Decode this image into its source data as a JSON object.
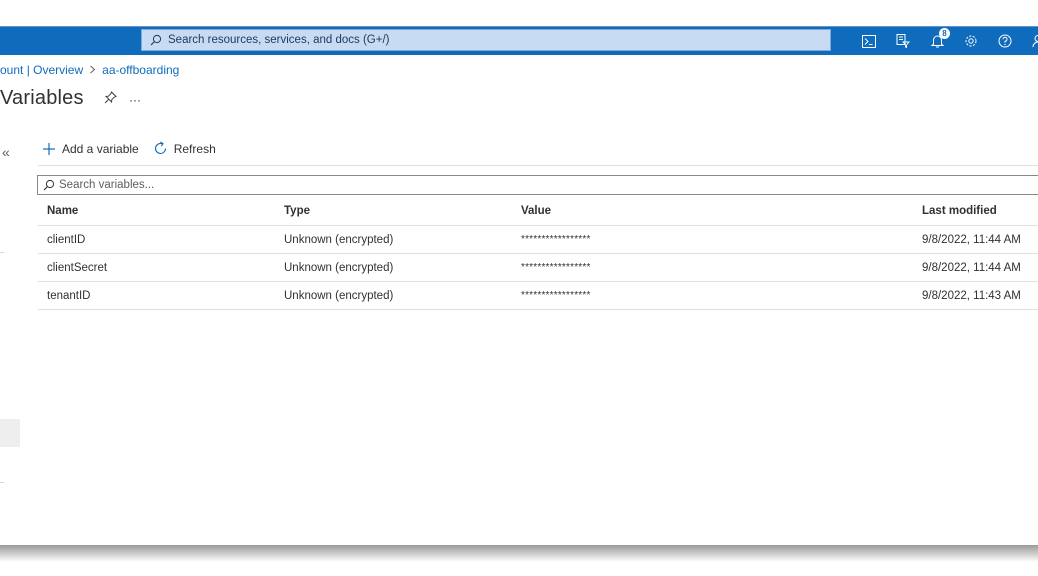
{
  "topbar": {
    "search_placeholder": "Search resources, services, and docs (G+/)",
    "notification_count": "8",
    "icons": [
      "cloud-shell-icon",
      "directory-filter-icon",
      "notifications-icon",
      "settings-icon",
      "help-icon",
      "feedback-icon"
    ]
  },
  "breadcrumb": {
    "items": [
      "ount | Overview",
      "aa-offboarding"
    ]
  },
  "page": {
    "title": "Variables",
    "more": "···"
  },
  "sidebar": {
    "collapse": "«"
  },
  "toolbar": {
    "add_label": "Add a variable",
    "refresh_label": "Refresh"
  },
  "search": {
    "placeholder": "Search variables..."
  },
  "table": {
    "columns": [
      "Name",
      "Type",
      "Value",
      "Last modified"
    ],
    "rows": [
      [
        "clientID",
        "Unknown (encrypted)",
        "*****************",
        "9/8/2022, 11:44 AM"
      ],
      [
        "clientSecret",
        "Unknown (encrypted)",
        "*****************",
        "9/8/2022, 11:44 AM"
      ],
      [
        "tenantID",
        "Unknown (encrypted)",
        "*****************",
        "9/8/2022, 11:43 AM"
      ]
    ]
  },
  "colors": {
    "accent": "#0f6cbd",
    "search_bg": "#c7dcf3",
    "text": "#323130",
    "divider": "#e1dfdd"
  }
}
